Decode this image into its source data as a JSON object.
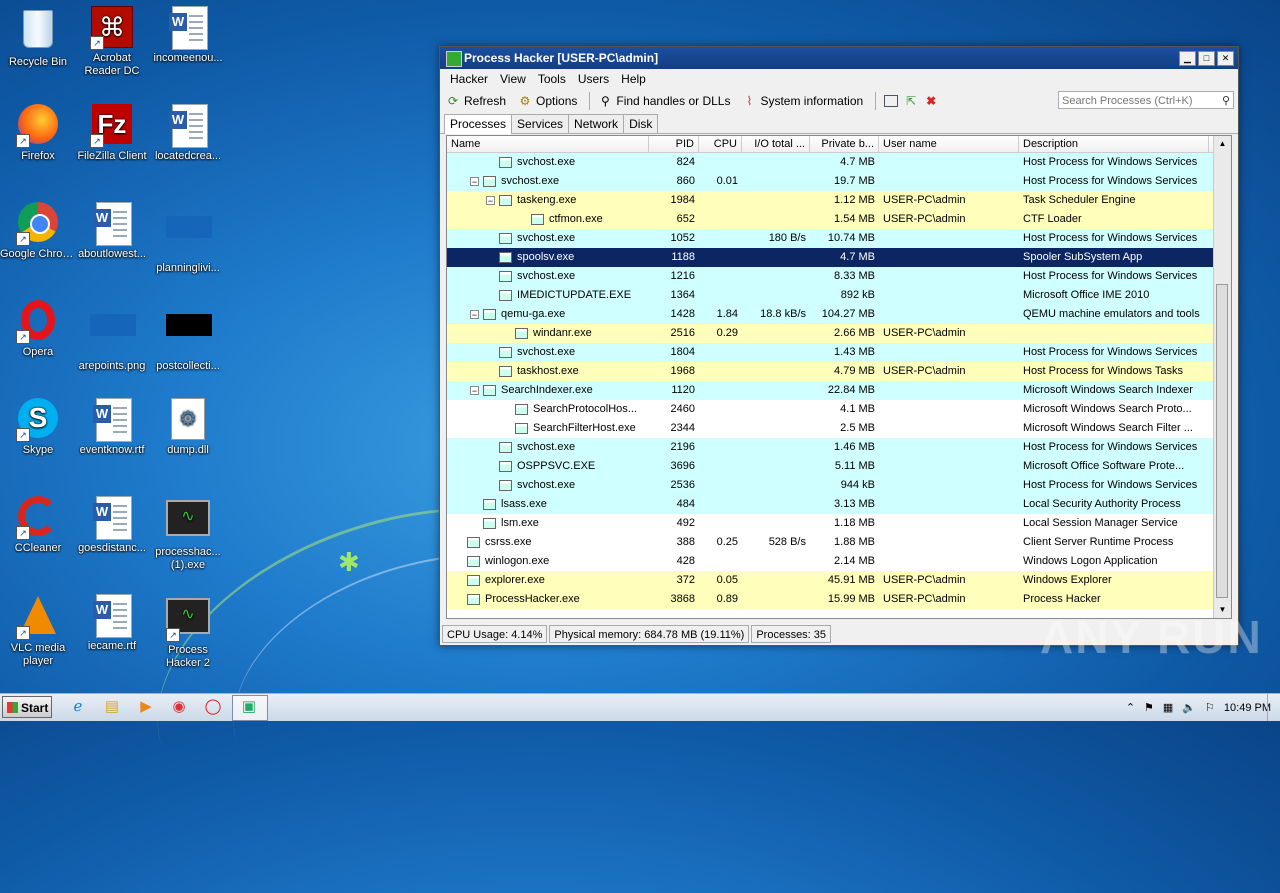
{
  "desktop": {
    "icons": [
      {
        "label": "Recycle Bin"
      },
      {
        "label": "Acrobat Reader DC"
      },
      {
        "label": "incomeenou..."
      },
      {
        "label": "Firefox"
      },
      {
        "label": "FileZilla Client"
      },
      {
        "label": "locatedcrea..."
      },
      {
        "label": "Google Chrome"
      },
      {
        "label": "aboutlowest..."
      },
      {
        "label": "planninglivi..."
      },
      {
        "label": "Opera"
      },
      {
        "label": "arepoints.png"
      },
      {
        "label": "postcollecti..."
      },
      {
        "label": "Skype"
      },
      {
        "label": "eventknow.rtf"
      },
      {
        "label": "dump.dll"
      },
      {
        "label": "CCleaner"
      },
      {
        "label": "goesdistanc..."
      },
      {
        "label": "processhac... (1).exe"
      },
      {
        "label": "VLC media player"
      },
      {
        "label": "iecame.rtf"
      },
      {
        "label": "Process Hacker 2"
      }
    ]
  },
  "window": {
    "title": "Process Hacker [USER-PC\\admin]",
    "menu": [
      "Hacker",
      "View",
      "Tools",
      "Users",
      "Help"
    ],
    "toolbar": {
      "refresh": "Refresh",
      "options": "Options",
      "find": "Find handles or DLLs",
      "sysinfo": "System information",
      "search_placeholder": "Search Processes (Ctrl+K)"
    },
    "tabs": [
      "Processes",
      "Services",
      "Network",
      "Disk"
    ],
    "columns": [
      "Name",
      "PID",
      "CPU",
      "I/O total ...",
      "Private b...",
      "User name",
      "Description"
    ],
    "rows": [
      {
        "name": "svchost.exe",
        "pid": "824",
        "cpu": "",
        "io": "",
        "priv": "4.7 MB",
        "user": "",
        "desc": "Host Process for Windows Services",
        "style": "svc",
        "indent": 3,
        "exp": ""
      },
      {
        "name": "svchost.exe",
        "pid": "860",
        "cpu": "0.01",
        "io": "",
        "priv": "19.7 MB",
        "user": "",
        "desc": "Host Process for Windows Services",
        "style": "svc",
        "indent": 2,
        "exp": "-"
      },
      {
        "name": "taskeng.exe",
        "pid": "1984",
        "cpu": "",
        "io": "",
        "priv": "1.12 MB",
        "user": "USER-PC\\admin",
        "desc": "Task Scheduler Engine",
        "style": "usr",
        "indent": 3,
        "exp": "-"
      },
      {
        "name": "ctfmon.exe",
        "pid": "652",
        "cpu": "",
        "io": "",
        "priv": "1.54 MB",
        "user": "USER-PC\\admin",
        "desc": "CTF Loader",
        "style": "usr",
        "indent": 5,
        "exp": ""
      },
      {
        "name": "svchost.exe",
        "pid": "1052",
        "cpu": "",
        "io": "180 B/s",
        "priv": "10.74 MB",
        "user": "",
        "desc": "Host Process for Windows Services",
        "style": "svc",
        "indent": 3,
        "exp": ""
      },
      {
        "name": "spoolsv.exe",
        "pid": "1188",
        "cpu": "",
        "io": "",
        "priv": "4.7 MB",
        "user": "",
        "desc": "Spooler SubSystem App",
        "style": "sel",
        "indent": 3,
        "exp": ""
      },
      {
        "name": "svchost.exe",
        "pid": "1216",
        "cpu": "",
        "io": "",
        "priv": "8.33 MB",
        "user": "",
        "desc": "Host Process for Windows Services",
        "style": "svc",
        "indent": 3,
        "exp": ""
      },
      {
        "name": "IMEDICTUPDATE.EXE",
        "pid": "1364",
        "cpu": "",
        "io": "",
        "priv": "892 kB",
        "user": "",
        "desc": "Microsoft Office IME 2010",
        "style": "svc",
        "indent": 3,
        "exp": ""
      },
      {
        "name": "qemu-ga.exe",
        "pid": "1428",
        "cpu": "1.84",
        "io": "18.8 kB/s",
        "priv": "104.27 MB",
        "user": "",
        "desc": "QEMU machine emulators and tools",
        "style": "svc",
        "indent": 2,
        "exp": "-"
      },
      {
        "name": "windanr.exe",
        "pid": "2516",
        "cpu": "0.29",
        "io": "",
        "priv": "2.66 MB",
        "user": "USER-PC\\admin",
        "desc": "",
        "style": "usr",
        "indent": 4,
        "exp": ""
      },
      {
        "name": "svchost.exe",
        "pid": "1804",
        "cpu": "",
        "io": "",
        "priv": "1.43 MB",
        "user": "",
        "desc": "Host Process for Windows Services",
        "style": "svc",
        "indent": 3,
        "exp": ""
      },
      {
        "name": "taskhost.exe",
        "pid": "1968",
        "cpu": "",
        "io": "",
        "priv": "4.79 MB",
        "user": "USER-PC\\admin",
        "desc": "Host Process for Windows Tasks",
        "style": "usr",
        "indent": 3,
        "exp": ""
      },
      {
        "name": "SearchIndexer.exe",
        "pid": "1120",
        "cpu": "",
        "io": "",
        "priv": "22.84 MB",
        "user": "",
        "desc": "Microsoft Windows Search Indexer",
        "style": "svc",
        "indent": 2,
        "exp": "-"
      },
      {
        "name": "SearchProtocolHos...",
        "pid": "2460",
        "cpu": "",
        "io": "",
        "priv": "4.1 MB",
        "user": "",
        "desc": "Microsoft Windows Search Proto...",
        "style": "plain",
        "indent": 4,
        "exp": ""
      },
      {
        "name": "SearchFilterHost.exe",
        "pid": "2344",
        "cpu": "",
        "io": "",
        "priv": "2.5 MB",
        "user": "",
        "desc": "Microsoft Windows Search Filter ...",
        "style": "plain",
        "indent": 4,
        "exp": ""
      },
      {
        "name": "svchost.exe",
        "pid": "2196",
        "cpu": "",
        "io": "",
        "priv": "1.46 MB",
        "user": "",
        "desc": "Host Process for Windows Services",
        "style": "svc",
        "indent": 3,
        "exp": ""
      },
      {
        "name": "OSPPSVC.EXE",
        "pid": "3696",
        "cpu": "",
        "io": "",
        "priv": "5.11 MB",
        "user": "",
        "desc": "Microsoft Office Software Prote...",
        "style": "svc",
        "indent": 3,
        "exp": ""
      },
      {
        "name": "svchost.exe",
        "pid": "2536",
        "cpu": "",
        "io": "",
        "priv": "944 kB",
        "user": "",
        "desc": "Host Process for Windows Services",
        "style": "svc",
        "indent": 3,
        "exp": ""
      },
      {
        "name": "lsass.exe",
        "pid": "484",
        "cpu": "",
        "io": "",
        "priv": "3.13 MB",
        "user": "",
        "desc": "Local Security Authority Process",
        "style": "svc",
        "indent": 2,
        "exp": ""
      },
      {
        "name": "lsm.exe",
        "pid": "492",
        "cpu": "",
        "io": "",
        "priv": "1.18 MB",
        "user": "",
        "desc": "Local Session Manager Service",
        "style": "plain",
        "indent": 2,
        "exp": ""
      },
      {
        "name": "csrss.exe",
        "pid": "388",
        "cpu": "0.25",
        "io": "528 B/s",
        "priv": "1.88 MB",
        "user": "",
        "desc": "Client Server Runtime Process",
        "style": "plain",
        "indent": 1,
        "exp": ""
      },
      {
        "name": "winlogon.exe",
        "pid": "428",
        "cpu": "",
        "io": "",
        "priv": "2.14 MB",
        "user": "",
        "desc": "Windows Logon Application",
        "style": "plain",
        "indent": 1,
        "exp": ""
      },
      {
        "name": "explorer.exe",
        "pid": "372",
        "cpu": "0.05",
        "io": "",
        "priv": "45.91 MB",
        "user": "USER-PC\\admin",
        "desc": "Windows Explorer",
        "style": "usr",
        "indent": 1,
        "exp": ""
      },
      {
        "name": "ProcessHacker.exe",
        "pid": "3868",
        "cpu": "0.89",
        "io": "",
        "priv": "15.99 MB",
        "user": "USER-PC\\admin",
        "desc": "Process Hacker",
        "style": "usr",
        "indent": 1,
        "exp": ""
      }
    ],
    "status": {
      "cpu": "CPU Usage: 4.14%",
      "mem": "Physical memory: 684.78 MB (19.11%)",
      "procs": "Processes: 35"
    }
  },
  "taskbar": {
    "start": "Start",
    "clock": "10:49 PM"
  },
  "watermark": "ANY RUN"
}
